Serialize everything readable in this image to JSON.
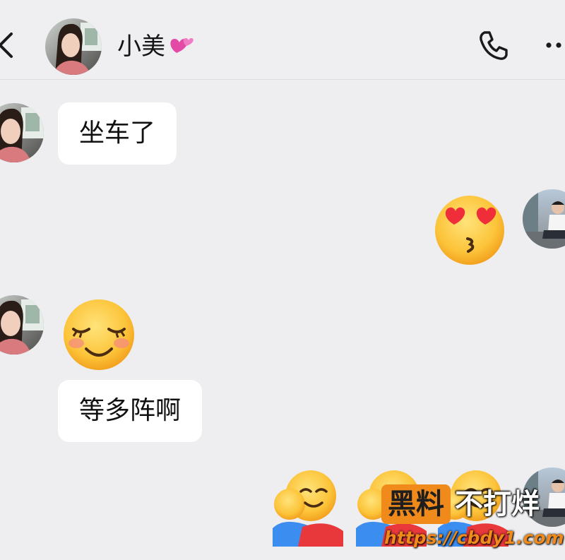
{
  "header": {
    "contact_name": "小美",
    "name_emoji": "revolving-hearts",
    "icons": [
      "back-icon",
      "phone-icon",
      "more-icon"
    ]
  },
  "messages": [
    {
      "side": "left",
      "type": "text",
      "text": "坐车了"
    },
    {
      "side": "right",
      "type": "emoji",
      "emoji": "face-blowing-kiss-with-heart-eyes"
    },
    {
      "side": "left",
      "type": "emoji",
      "emoji": "blushing-smiling-face"
    },
    {
      "side": "left",
      "type": "text",
      "text": "等多阵啊"
    },
    {
      "side": "right",
      "type": "emoji",
      "emoji": "hugging-face",
      "count": 3
    }
  ],
  "watermark": {
    "box_text": "黑料",
    "text": "不打烊",
    "url": "https://cbdy1.com"
  },
  "colors": {
    "background": "#eeedf0",
    "bubble": "#ffffff",
    "watermark_orange": "#f08a1a"
  }
}
